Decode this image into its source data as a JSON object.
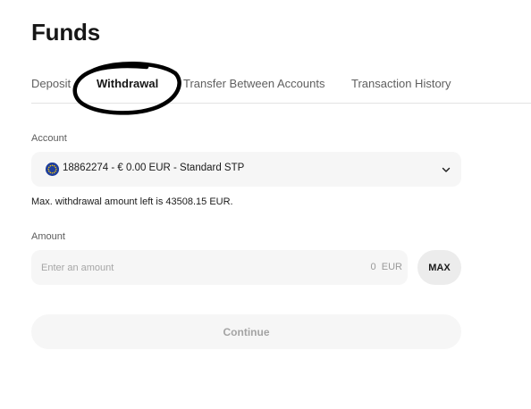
{
  "page": {
    "title": "Funds"
  },
  "tabs": [
    {
      "label": "Deposit",
      "active": false
    },
    {
      "label": "Withdrawal",
      "active": true
    },
    {
      "label": "Transfer Between Accounts",
      "active": false
    },
    {
      "label": "Transaction History",
      "active": false
    }
  ],
  "annotation": {
    "color": "#000000"
  },
  "form": {
    "account_label": "Account",
    "account": {
      "flag_icon": "eu-flag-icon",
      "value": "18862274 - € 0.00 EUR - Standard STP",
      "dropdown_icon": "chevron-down-icon"
    },
    "max_note": "Max. withdrawal amount left is 43508.15 EUR.",
    "amount_label": "Amount",
    "amount": {
      "placeholder": "Enter an amount",
      "value": "",
      "display_value": "0",
      "currency": "EUR"
    },
    "max_button_label": "MAX",
    "continue_label": "Continue"
  },
  "colors": {
    "field_background": "#f6f6f6",
    "max_background": "#ececec",
    "flag_blue": "#1f3f9c",
    "flag_stars": "#ffcc00",
    "divider": "#e3e3e3"
  }
}
